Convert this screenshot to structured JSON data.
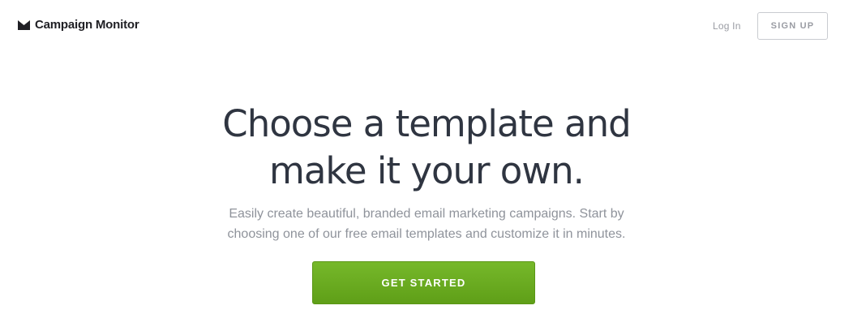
{
  "header": {
    "logo_icon": "envelope-logo-icon",
    "logo_text": "Campaign Monitor",
    "login_label": "Log In",
    "signup_label": "SIGN UP"
  },
  "hero": {
    "title_line1": "Choose a template and",
    "title_line2": "make it your own.",
    "subtitle_line1": "Easily create beautiful, branded email marketing campaigns. Start by",
    "subtitle_line2": "choosing one of our free email templates and customize it in minutes.",
    "cta_label": "GET STARTED"
  },
  "colors": {
    "title": "#2f3541",
    "subtitle": "#8f939b",
    "cta_green": "#6aab21",
    "muted_link": "#9a9ca3"
  }
}
